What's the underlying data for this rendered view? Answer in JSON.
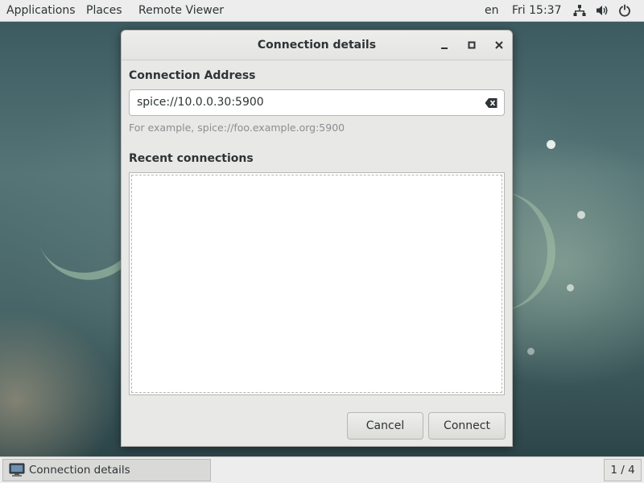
{
  "top_bar": {
    "menus": [
      "Applications",
      "Places",
      "Remote Viewer"
    ],
    "language": "en",
    "clock": "Fri 15:37",
    "status_icons": [
      "network-icon",
      "volume-icon",
      "power-icon"
    ]
  },
  "dialog": {
    "title": "Connection details",
    "window_buttons": [
      "minimize-icon",
      "maximize-icon",
      "close-icon"
    ],
    "address_label": "Connection Address",
    "address_value": "spice://10.0.0.30:5900",
    "address_hint": "For example, spice://foo.example.org:5900",
    "recent_label": "Recent connections",
    "recent_items": [],
    "cancel_label": "Cancel",
    "connect_label": "Connect"
  },
  "taskbar": {
    "task_label": "Connection details",
    "workspace": "1 / 4"
  }
}
